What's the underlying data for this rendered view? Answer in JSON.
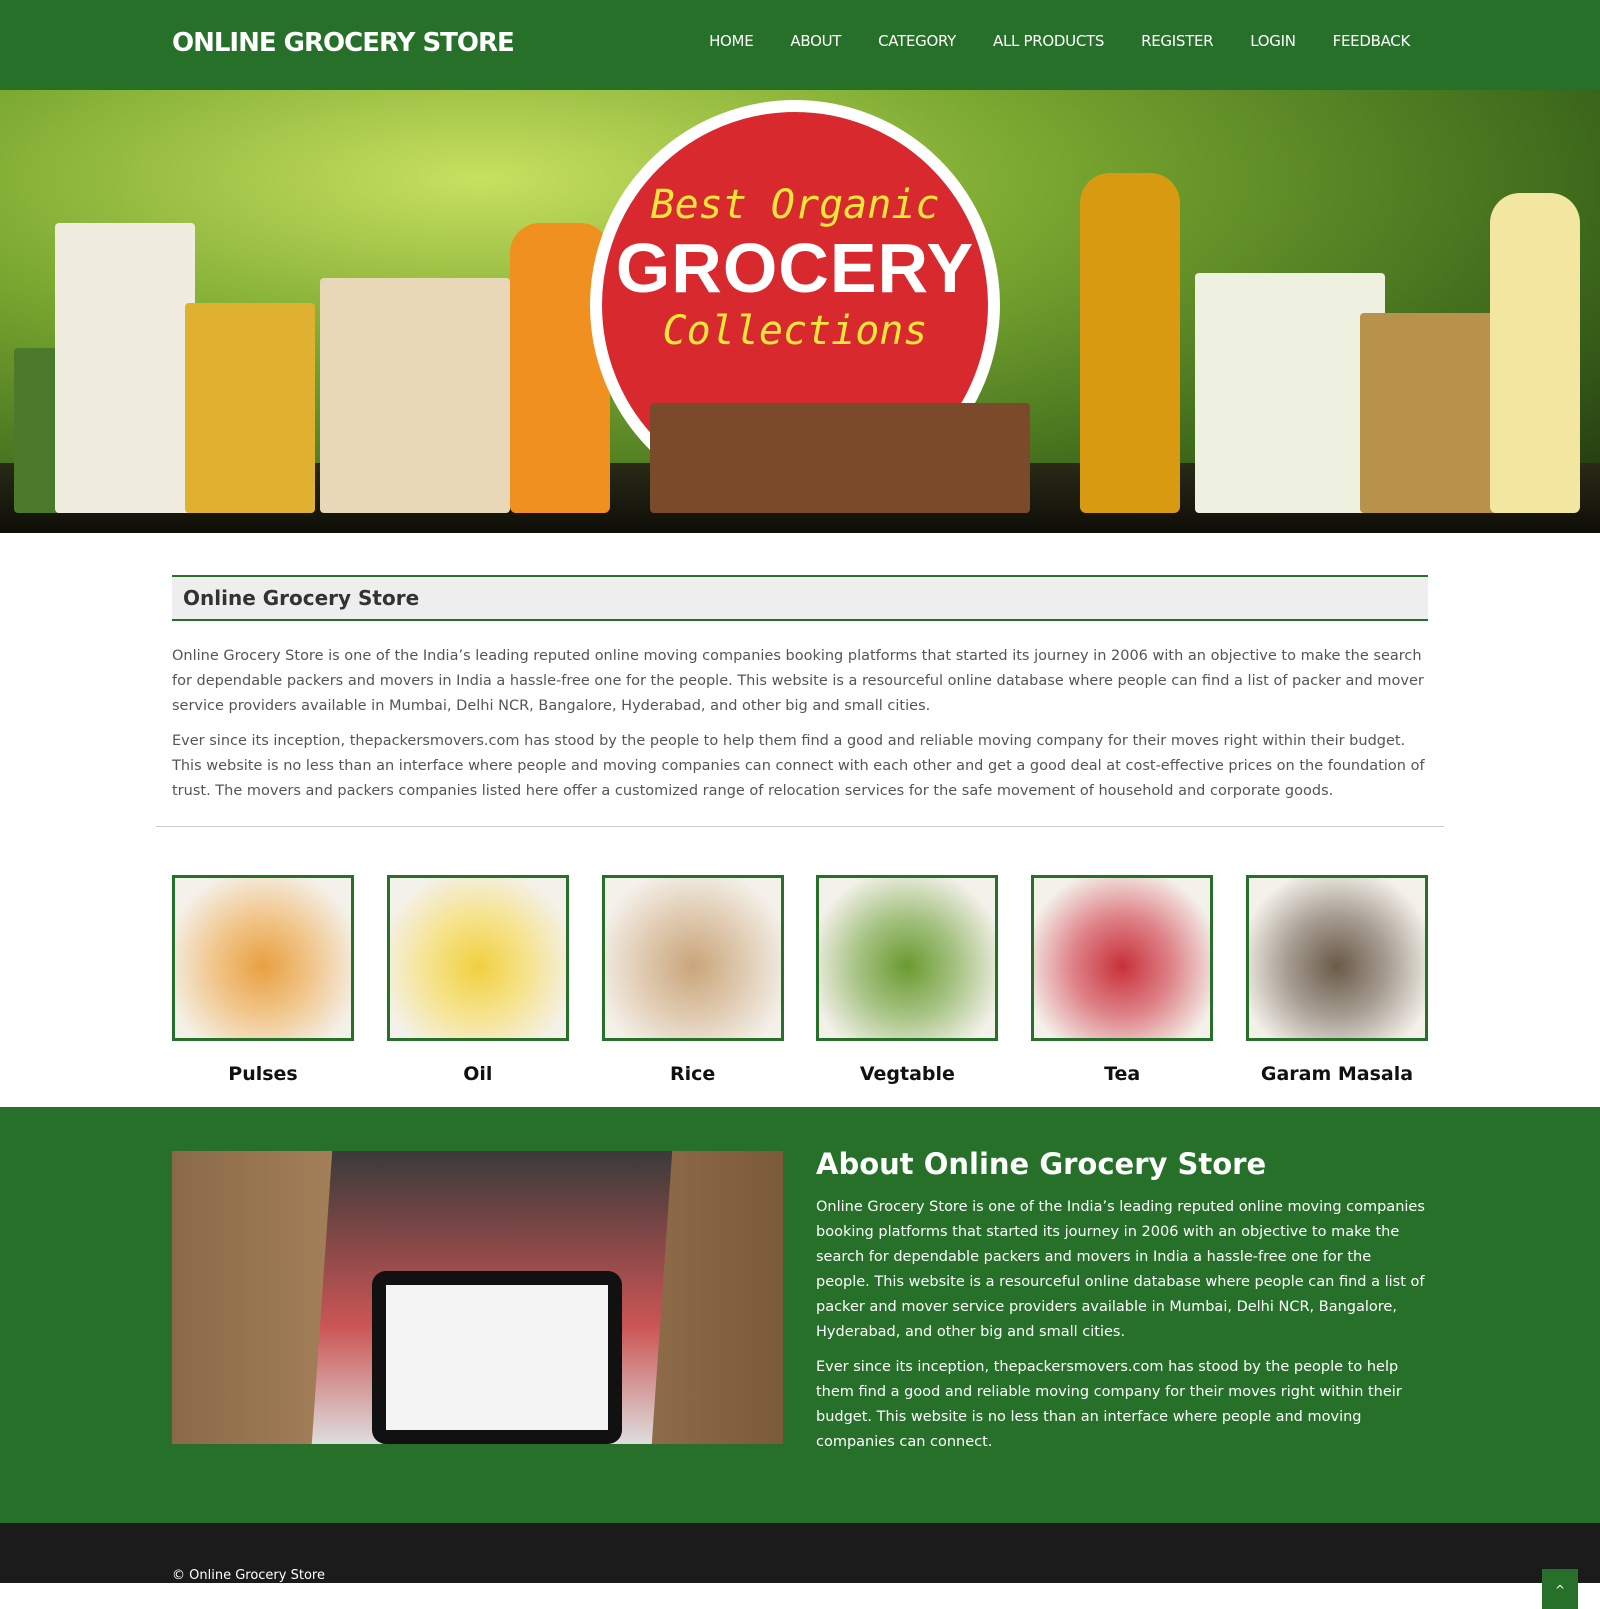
{
  "header": {
    "brand": "ONLINE GROCERY STORE",
    "nav": [
      "HOME",
      "ABOUT",
      "CATEGORY",
      "ALL PRODUCTS",
      "REGISTER",
      "LOGIN",
      "FEEDBACK"
    ]
  },
  "hero": {
    "line1": "Best Organic",
    "line2": "GROCERY",
    "line3": "Collections"
  },
  "intro": {
    "title": "Online Grocery Store",
    "p1": "Online Grocery Store is one of the India’s leading reputed online moving companies booking platforms that started its journey in 2006 with an objective to make the search for dependable packers and movers in India a hassle-free one for the people. This website is a resourceful online database where people can find a list of packer and mover service providers available in Mumbai, Delhi NCR, Bangalore, Hyderabad, and other big and small cities.",
    "p2": "Ever since its inception, thepackersmovers.com has stood by the people to help them find a good and reliable moving company for their moves right within their budget. This website is no less than an interface where people and moving companies can connect with each other and get a good deal at cost-effective prices on the foundation of trust. The movers and packers companies listed here offer a customized range of relocation services for the safe movement of household and corporate goods."
  },
  "categories": [
    {
      "label": "Pulses",
      "color": "#e8a040"
    },
    {
      "label": "Oil",
      "color": "#f0d040"
    },
    {
      "label": "Rice",
      "color": "#c9a57a"
    },
    {
      "label": "Vegtable",
      "color": "#6a9a30"
    },
    {
      "label": "Tea",
      "color": "#c8303a"
    },
    {
      "label": "Garam Masala",
      "color": "#6a5a48"
    }
  ],
  "about": {
    "title": "About Online Grocery Store",
    "p1": "Online Grocery Store is one of the India’s leading reputed online moving companies booking platforms that started its journey in 2006 with an objective to make the search for dependable packers and movers in India a hassle-free one for the people. This website is a resourceful online database where people can find a list of packer and mover service providers available in Mumbai, Delhi NCR, Bangalore, Hyderabad, and other big and small cities.",
    "p2": "Ever since its inception, thepackersmovers.com has stood by the people to help them find a good and reliable moving company for their moves right within their budget. This website is no less than an interface where people and moving companies can connect."
  },
  "footer": {
    "copyright": "© Online Grocery Store",
    "back_to_top": "^"
  },
  "colors": {
    "primary": "#26702a",
    "footer": "#1b1b1b"
  }
}
